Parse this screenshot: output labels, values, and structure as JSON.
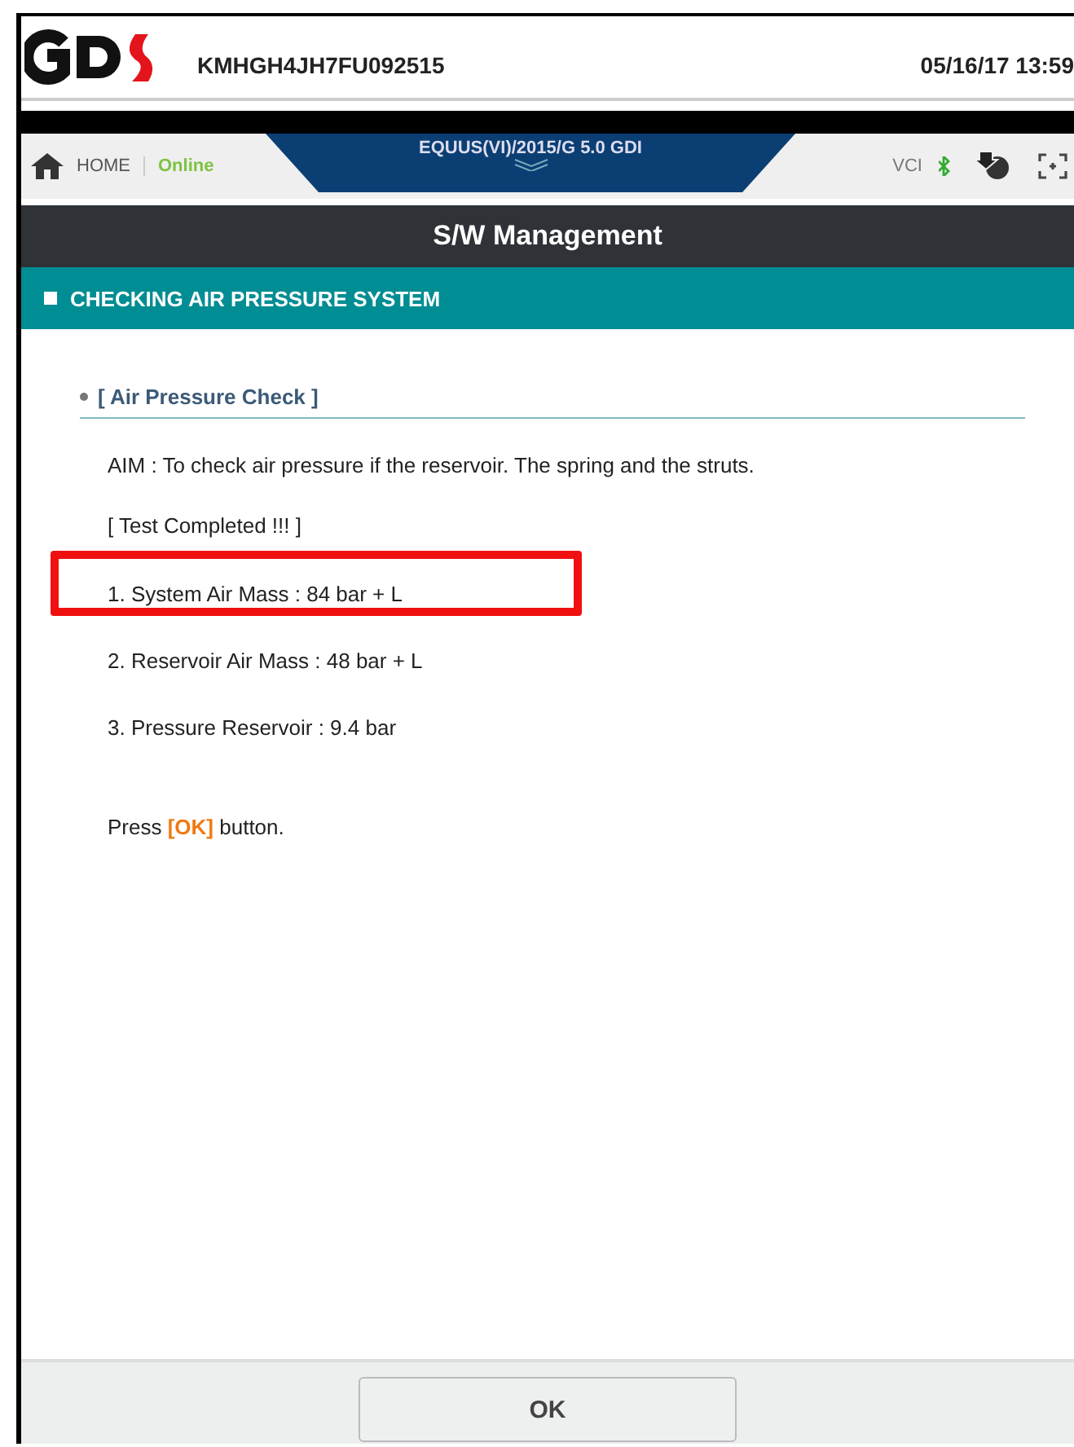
{
  "header": {
    "vin": "KMHGH4JH7FU092515",
    "datetime": "05/16/17 13:59"
  },
  "nav": {
    "home": "HOME",
    "status": "Online",
    "vehicle": "EQUUS(VI)/2015/G 5.0 GDI",
    "vci": "VCI"
  },
  "title": "S/W Management",
  "section": "CHECKING AIR PRESSURE SYSTEM",
  "subheading": "[ Air Pressure Check ]",
  "aim": "AIM : To check air pressure if the reservoir. The spring and the struts.",
  "result_title": "[ Test Completed !!! ]",
  "results": [
    {
      "text": "1. System Air Mass : 84 bar + L",
      "highlighted": true
    },
    {
      "text": "2. Reservoir Air Mass : 48 bar + L",
      "highlighted": false
    },
    {
      "text": "3. Pressure Reservoir : 9.4 bar",
      "highlighted": false
    }
  ],
  "prompt": {
    "before": "Press",
    "key": "[OK]",
    "after": "button."
  },
  "buttons": [
    "OK"
  ]
}
